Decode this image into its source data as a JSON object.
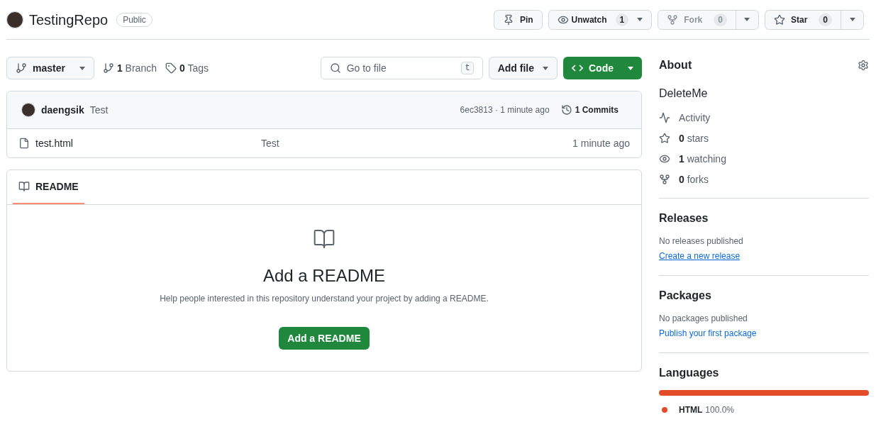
{
  "repo": {
    "name": "TestingRepo",
    "visibility": "Public"
  },
  "header_actions": [
    {
      "kind": "plain",
      "label": "Pin",
      "disabled": false
    },
    {
      "kind": "counter",
      "label": "Unwatch",
      "count": "1",
      "disabled": false
    },
    {
      "kind": "split",
      "label": "Fork",
      "count": "0",
      "disabled": true
    },
    {
      "kind": "split",
      "label": "Star",
      "count": "0",
      "disabled": false
    }
  ],
  "toolbar": {
    "branch": "master",
    "branches": "**1** Branch",
    "tags": "**0** Tags",
    "search": {
      "placeholder": "Go to file",
      "shortcut": "t"
    },
    "add_file": "Add file",
    "code": "Code"
  },
  "commit": {
    "author": "daengsik",
    "message": "Test",
    "hash_time": "6ec3813 · 1 minute ago",
    "commits": "1 Commits"
  },
  "files": [
    {
      "name": "test.html",
      "message": "Test",
      "time": "1 minute ago"
    }
  ],
  "readme": {
    "tabs": [
      {
        "label": "README",
        "selected": true
      }
    ],
    "title": "Add a README",
    "description": "Help people interested in this repository understand your project by adding a README.",
    "button": "Add a README"
  },
  "about": {
    "title": "About",
    "description": "DeleteMe",
    "stats": [
      {
        "text": "Activity"
      },
      {
        "text": "**0** stars"
      },
      {
        "text": "**1** watching"
      },
      {
        "text": "**0** forks"
      }
    ]
  },
  "releases": {
    "title": "Releases",
    "note": "No releases published",
    "link": "Create a new release",
    "underlined": true
  },
  "packages": {
    "title": "Packages",
    "note": "No packages published",
    "link": "Publish your first package",
    "underlined": false
  },
  "languages": {
    "title": "Languages",
    "items": [
      {
        "name": "HTML",
        "percent": "100.0%",
        "level": 1.0,
        "color": "#e34c26"
      }
    ]
  }
}
